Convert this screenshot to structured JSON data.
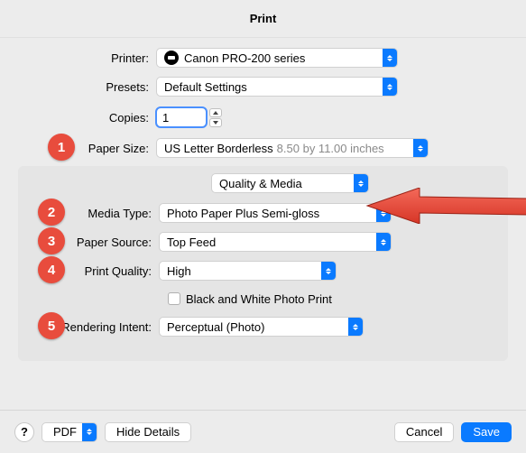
{
  "title": "Print",
  "labels": {
    "printer": "Printer:",
    "presets": "Presets:",
    "copies": "Copies:",
    "paper_size": "Paper Size:",
    "media_type": "Media Type:",
    "paper_source": "Paper Source:",
    "print_quality": "Print Quality:",
    "rendering_intent": "Rendering Intent:"
  },
  "printer": {
    "value": "Canon PRO-200 series"
  },
  "presets": {
    "value": "Default Settings"
  },
  "copies": {
    "value": "1"
  },
  "paper_size": {
    "value": "US Letter Borderless",
    "dimensions": "8.50 by 11.00 inches"
  },
  "section_select": {
    "value": "Quality & Media"
  },
  "media_type": {
    "value": "Photo Paper Plus Semi-gloss"
  },
  "paper_source": {
    "value": "Top Feed"
  },
  "print_quality": {
    "value": "High"
  },
  "bw_checkbox": {
    "label": "Black and White Photo Print",
    "checked": false
  },
  "rendering_intent": {
    "value": "Perceptual (Photo)"
  },
  "badges": {
    "1": "1",
    "2": "2",
    "3": "3",
    "4": "4",
    "5": "5"
  },
  "footer": {
    "help": "?",
    "pdf": "PDF",
    "hide_details": "Hide Details",
    "cancel": "Cancel",
    "save": "Save"
  }
}
